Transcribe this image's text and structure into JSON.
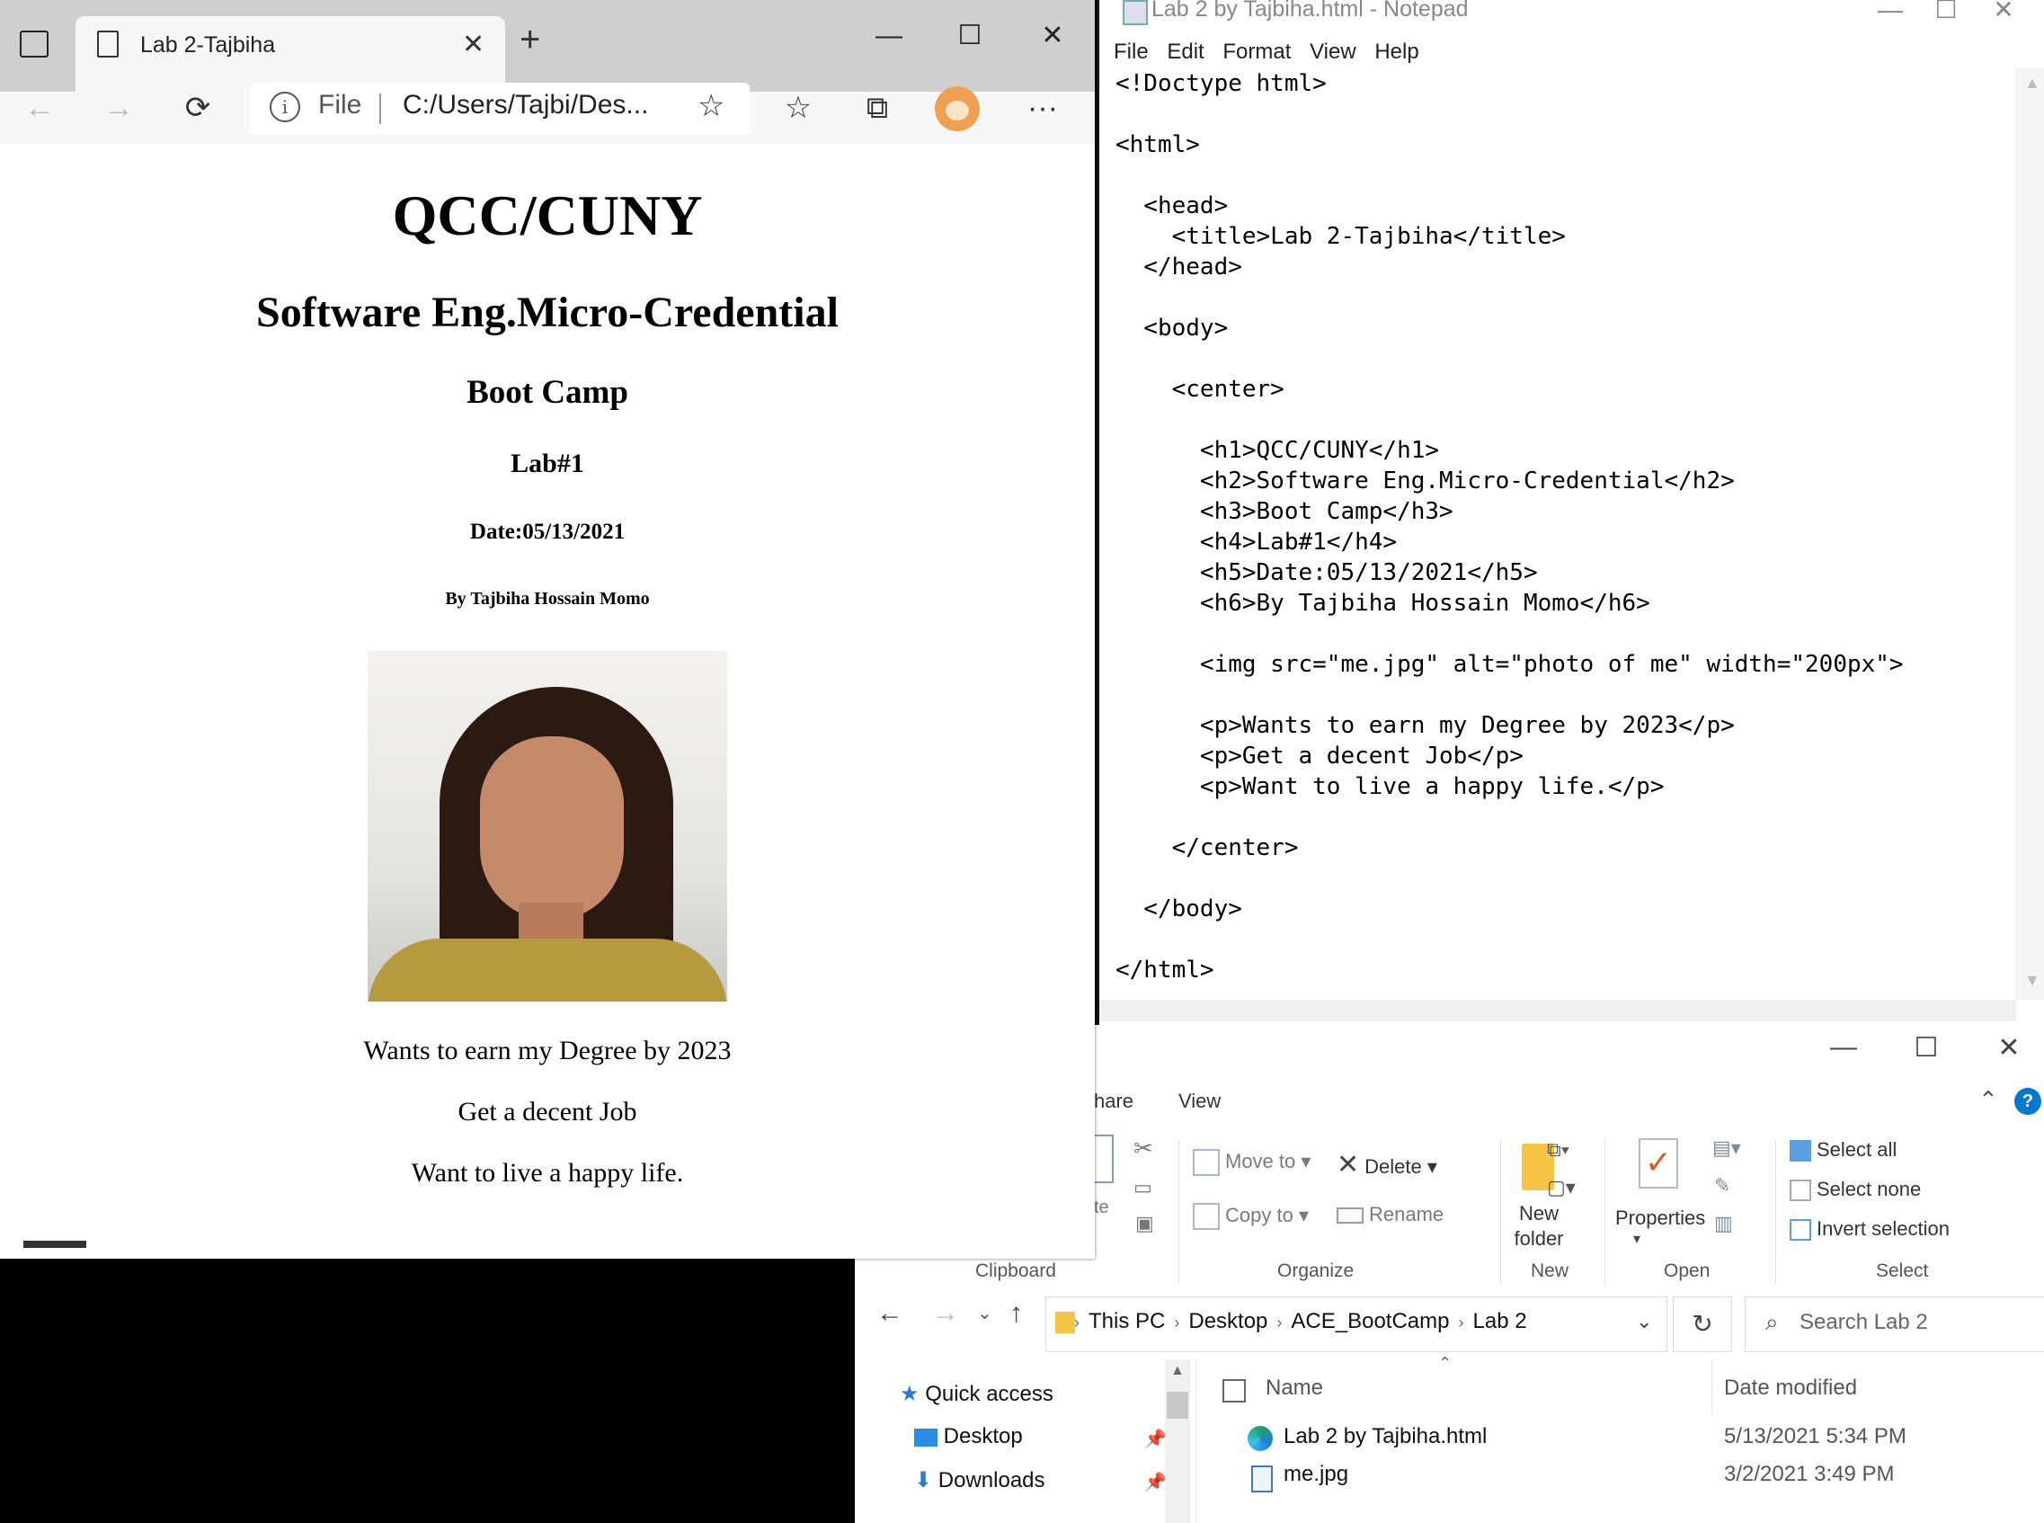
{
  "notepad": {
    "title": "Lab 2 by Tajbiha.html - Notepad",
    "menu": [
      "File",
      "Edit",
      "Format",
      "View",
      "Help"
    ],
    "code": "<!Doctype html>\n\n<html>\n\n  <head>\n    <title>Lab 2-Tajbiha</title>\n  </head>\n\n  <body>\n\n    <center>\n\n      <h1>QCC/CUNY</h1>\n      <h2>Software Eng.Micro-Credential</h2>\n      <h3>Boot Camp</h3>\n      <h4>Lab#1</h4>\n      <h5>Date:05/13/2021</h5>\n      <h6>By Tajbiha Hossain Momo</h6>\n\n      <img src=\"me.jpg\" alt=\"photo of me\" width=\"200px\">\n\n      <p>Wants to earn my Degree by 2023</p>\n      <p>Get a decent Job</p>\n      <p>Want to live a happy life.</p>\n\n    </center>\n\n  </body>\n\n</html>",
    "controls": {
      "minimize": "—",
      "maximize": "☐",
      "close": "✕"
    }
  },
  "browser": {
    "tab_title": "Lab 2-Tajbiha",
    "tab_close": "✕",
    "new_tab": "+",
    "controls": {
      "minimize": "—",
      "maximize": "☐",
      "close": "✕"
    },
    "nav": {
      "back": "←",
      "forward": "→",
      "refresh": "⟳"
    },
    "address": {
      "info": "i",
      "scheme": "File",
      "url": "C:/Users/Tajbi/Des..."
    },
    "toolbar_icons": {
      "add_favorite": "☆",
      "favorites": "☆",
      "collections": "⧉",
      "more": "···"
    },
    "page": {
      "h1": "QCC/CUNY",
      "h2": "Software Eng.Micro-Credential",
      "h3": "Boot Camp",
      "h4": "Lab#1",
      "h5": "Date:05/13/2021",
      "h6": "By Tajbiha Hossain Momo",
      "p1": "Wants to earn my Degree by 2023",
      "p2": "Get a decent Job",
      "p3": "Want to live a happy life."
    }
  },
  "explorer": {
    "controls": {
      "minimize": "—",
      "maximize": "☐",
      "close": "✕"
    },
    "tabs": {
      "share_partial": "hare",
      "view": "View"
    },
    "ribbon": {
      "clipboard_partial": "te",
      "move_to": "Move to",
      "copy_to": "Copy to",
      "delete": "Delete",
      "rename": "Rename",
      "new_folder_line1": "New",
      "new_folder_line2": "folder",
      "properties": "Properties",
      "select_all": "Select all",
      "select_none": "Select none",
      "invert_selection": "Invert selection",
      "groups": {
        "clipboard": "Clipboard",
        "organize": "Organize",
        "new": "New",
        "open": "Open",
        "select": "Select"
      }
    },
    "breadcrumbs": [
      "This PC",
      "Desktop",
      "ACE_BootCamp",
      "Lab 2"
    ],
    "search_placeholder": "Search Lab 2",
    "nav": {
      "quick_access": "Quick access",
      "desktop": "Desktop",
      "downloads": "Downloads"
    },
    "columns": {
      "name": "Name",
      "date_modified": "Date modified"
    },
    "files": [
      {
        "name": "Lab 2 by Tajbiha.html",
        "date": "5/13/2021 5:34 PM"
      },
      {
        "name": "me.jpg",
        "date": "3/2/2021 3:49 PM"
      }
    ]
  },
  "colors": {
    "accent": "#0078d4",
    "notepad_title": "#888888",
    "edge_tabstrip": "#cfcfcf"
  }
}
